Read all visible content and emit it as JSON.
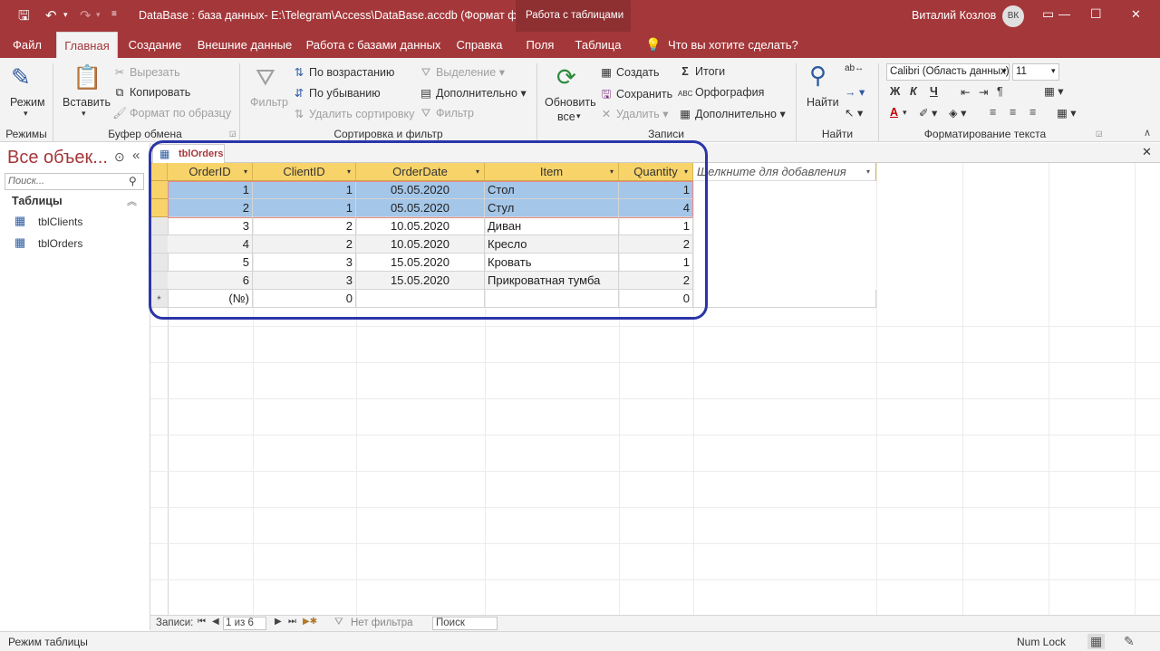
{
  "title_bar": {
    "document_title": "DataBase : база данных- E:\\Telegram\\Access\\DataBase.accdb (Формат фа...",
    "context_group": "Работа с таблицами",
    "user_name": "Виталий Козлов",
    "user_initials": "ВК",
    "minimize": "—",
    "maximize": "☐",
    "close": "✕"
  },
  "tabs": [
    "Файл",
    "Главная",
    "Создание",
    "Внешние данные",
    "Работа с базами данных",
    "Справка",
    "Поля",
    "Таблица"
  ],
  "tell_me": "Что вы хотите сделать?",
  "ribbon": {
    "views": {
      "mode": "Режим",
      "group": "Режимы"
    },
    "clipboard": {
      "paste": "Вставить",
      "cut": "Вырезать",
      "copy": "Копировать",
      "format_painter": "Формат по образцу",
      "group": "Буфер обмена"
    },
    "sort_filter": {
      "filter": "Фильтр",
      "ascending": "По возрастанию",
      "descending": "По убыванию",
      "remove_sort": "Удалить сортировку",
      "selection": "Выделение",
      "advanced": "Дополнительно",
      "toggle_filter": "Фильтр",
      "group": "Сортировка и фильтр"
    },
    "records": {
      "refresh": "Обновить",
      "refresh_all": "все",
      "new": "Создать",
      "save": "Сохранить",
      "delete": "Удалить",
      "totals": "Итоги",
      "spelling": "Орфография",
      "more": "Дополнительно",
      "group": "Записи"
    },
    "find": {
      "find": "Найти",
      "group": "Найти"
    },
    "text_formatting": {
      "font": "Calibri (Область данных)",
      "size": "11",
      "bold": "Ж",
      "italic": "К",
      "underline": "Ч",
      "group": "Форматирование текста"
    }
  },
  "nav_pane": {
    "title": "Все объек...",
    "search_placeholder": "Поиск...",
    "section": "Таблицы",
    "items": [
      "tblClients",
      "tblOrders"
    ]
  },
  "document": {
    "tab": "tblOrders",
    "columns": [
      "OrderID",
      "ClientID",
      "OrderDate",
      "Item",
      "Quantity"
    ],
    "add_column": "Щелкните для добавления",
    "rows": [
      [
        "1",
        "1",
        "05.05.2020",
        "Стол",
        "1"
      ],
      [
        "2",
        "1",
        "05.05.2020",
        "Стул",
        "4"
      ],
      [
        "3",
        "2",
        "10.05.2020",
        "Диван",
        "1"
      ],
      [
        "4",
        "2",
        "10.05.2020",
        "Кресло",
        "2"
      ],
      [
        "5",
        "3",
        "15.05.2020",
        "Кровать",
        "1"
      ],
      [
        "6",
        "3",
        "15.05.2020",
        "Прикроватная тумба",
        "2"
      ]
    ],
    "new_row": {
      "marker": "*",
      "id": "(№)",
      "client": "0",
      "qty": "0"
    }
  },
  "record_nav": {
    "label": "Записи:",
    "position": "1 из 6",
    "filter": "Нет фильтра",
    "search": "Поиск"
  },
  "status": {
    "mode": "Режим таблицы",
    "num_lock": "Num Lock"
  },
  "colors": {
    "accent": "#a4373a",
    "header": "#f7d36a",
    "selection": "#a4c6e8",
    "highlight_box": "#2b35a8"
  }
}
